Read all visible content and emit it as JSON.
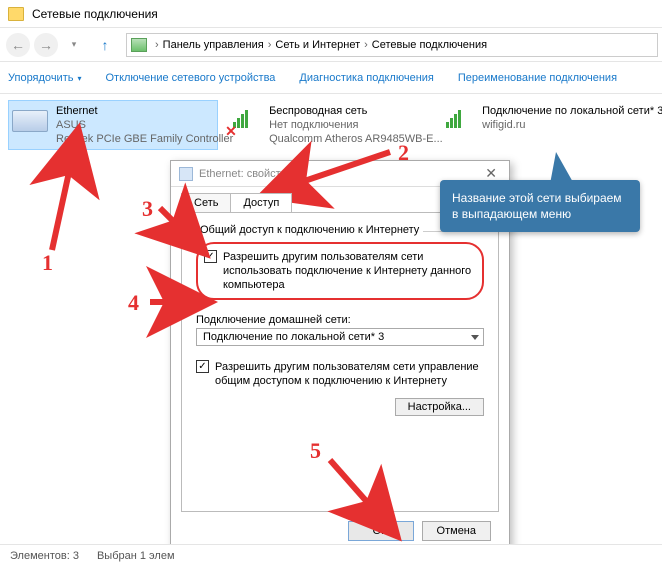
{
  "window": {
    "title": "Сетевые подключения"
  },
  "breadcrumb": {
    "root": "Панель управления",
    "mid": "Сеть и Интернет",
    "leaf": "Сетевые подключения"
  },
  "toolbar": {
    "organize": "Упорядочить",
    "disable": "Отключение сетевого устройства",
    "diagnose": "Диагностика подключения",
    "rename": "Переименование подключения"
  },
  "networks": [
    {
      "name": "Ethernet",
      "sub1": "ASUS",
      "sub2": "Realtek PCIe GBE Family Controller"
    },
    {
      "name": "Беспроводная сеть",
      "sub1": "Нет подключения",
      "sub2": "Qualcomm Atheros AR9485WB-E..."
    },
    {
      "name": "Подключение по локальной сети* 3",
      "sub1": "wifigid.ru",
      "sub2": ""
    }
  ],
  "dialog": {
    "title": "Ethernet: свойства",
    "tab_net": "Сеть",
    "tab_share": "Доступ",
    "group_ics": "Общий доступ к подключению к Интернету",
    "allow_share": "Разрешить другим пользователям сети использовать подключение к Интернету данного компьютера",
    "home_label": "Подключение домашней сети:",
    "home_value": "Подключение по локальной сети* 3",
    "allow_control": "Разрешить другим пользователям сети управление общим доступом к подключению к Интернету",
    "settings_btn": "Настройка...",
    "ok": "OK",
    "cancel": "Отмена"
  },
  "status": {
    "elements": "Элементов: 3",
    "selected": "Выбран 1 элем"
  },
  "callout": {
    "text": "Название этой сети выбираем в выпадающем меню"
  },
  "annotations": {
    "n1": "1",
    "n2": "2",
    "n3": "3",
    "n4": "4",
    "n5": "5"
  }
}
